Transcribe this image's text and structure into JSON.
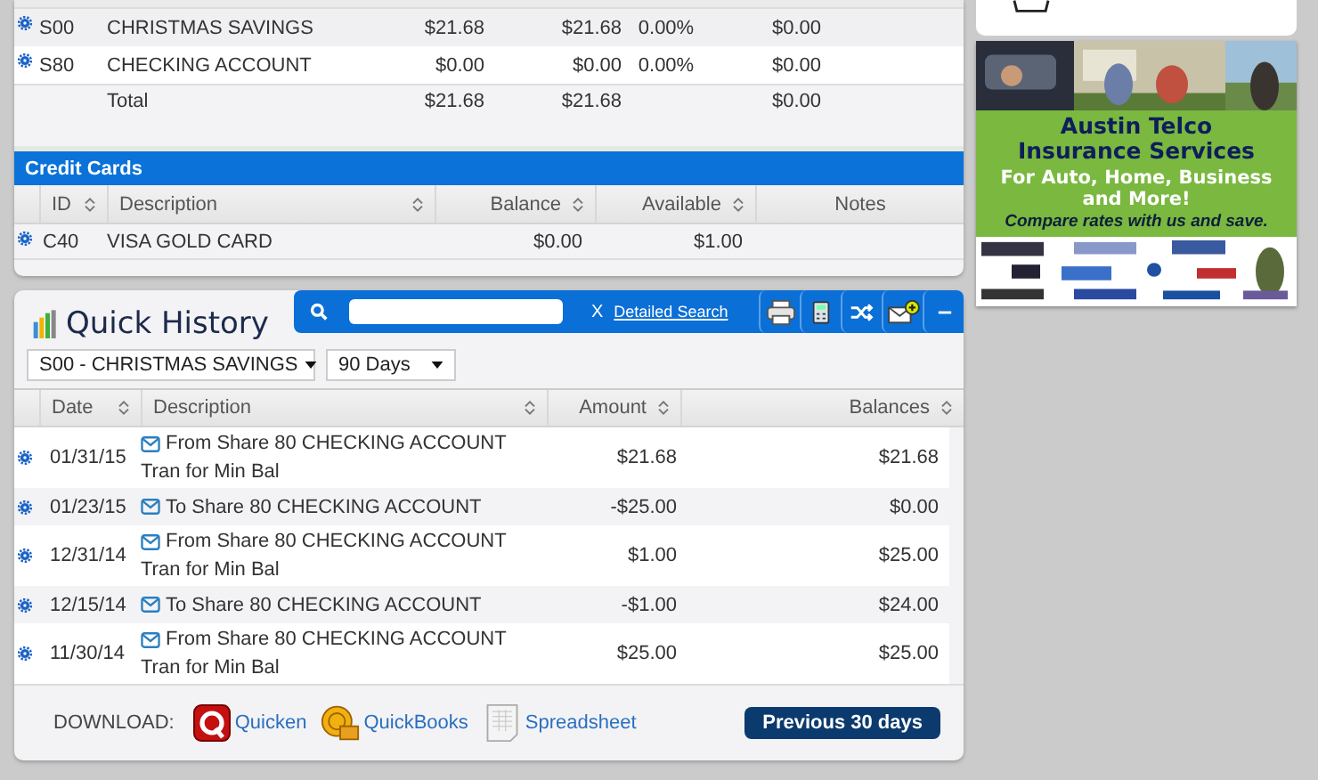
{
  "accounts": {
    "rows": [
      {
        "id": "S00",
        "description": "CHRISTMAS SAVINGS",
        "column_3": "$21.68",
        "column_4": "$21.68",
        "column_5": "0.00%",
        "column_6": "$0.00"
      },
      {
        "id": "S80",
        "description": "CHECKING ACCOUNT",
        "column_3": "$0.00",
        "column_4": "$0.00",
        "column_5": "0.00%",
        "column_6": "$0.00"
      }
    ],
    "total": {
      "label": "Total",
      "column_3": "$21.68",
      "column_4": "$21.68",
      "column_6": "$0.00"
    }
  },
  "credit_cards": {
    "title": "Credit Cards",
    "columns": [
      {
        "label": "ID",
        "sortable": true
      },
      {
        "label": "Description",
        "sortable": true
      },
      {
        "label": "Balance",
        "sortable": true
      },
      {
        "label": "Available",
        "sortable": true
      },
      {
        "label": "Notes",
        "sortable": false
      }
    ],
    "rows": [
      {
        "id": "C40",
        "description": "VISA GOLD CARD",
        "balance": "$0.00",
        "available": "$1.00"
      }
    ]
  },
  "quick_history": {
    "title": "Quick History",
    "search": {
      "clear": "X",
      "link": "Detailed Search"
    },
    "account_select": "S00 - CHRISTMAS SAVINGS",
    "period_select": "90 Days",
    "columns": [
      {
        "label": "Date"
      },
      {
        "label": "Description"
      },
      {
        "label": "Amount"
      },
      {
        "label": "Balances"
      }
    ],
    "rows": [
      {
        "date": "01/31/15",
        "description": "From Share 80 CHECKING ACCOUNT",
        "memo": "Tran for Min Bal",
        "amount": "$21.68",
        "balance": "$21.68"
      },
      {
        "date": "01/23/15",
        "description": "To Share 80 CHECKING ACCOUNT",
        "amount": "-$25.00",
        "balance": "$0.00"
      },
      {
        "date": "12/31/14",
        "description": "From Share 80 CHECKING ACCOUNT",
        "memo": "Tran for Min Bal",
        "amount": "$1.00",
        "balance": "$25.00"
      },
      {
        "date": "12/15/14",
        "description": "To Share 80 CHECKING ACCOUNT",
        "amount": "-$1.00",
        "balance": "$24.00"
      },
      {
        "date": "11/30/14",
        "description": "From Share 80 CHECKING ACCOUNT",
        "memo": "Tran for Min Bal",
        "amount": "$25.00",
        "balance": "$25.00"
      }
    ],
    "download_label": "DOWNLOAD:",
    "downloads": [
      {
        "kind": "quicken",
        "label": "Quicken"
      },
      {
        "kind": "quickbooks",
        "label": "QuickBooks"
      },
      {
        "kind": "spreadsheet",
        "label": "Spreadsheet"
      }
    ],
    "previous_button": "Previous 30 days"
  },
  "ad": {
    "headline": "Austin Telco",
    "headline_2": "Insurance Services",
    "tagline": "For Auto, Home, Business and More!",
    "slogan": "Compare rates with us and save."
  }
}
